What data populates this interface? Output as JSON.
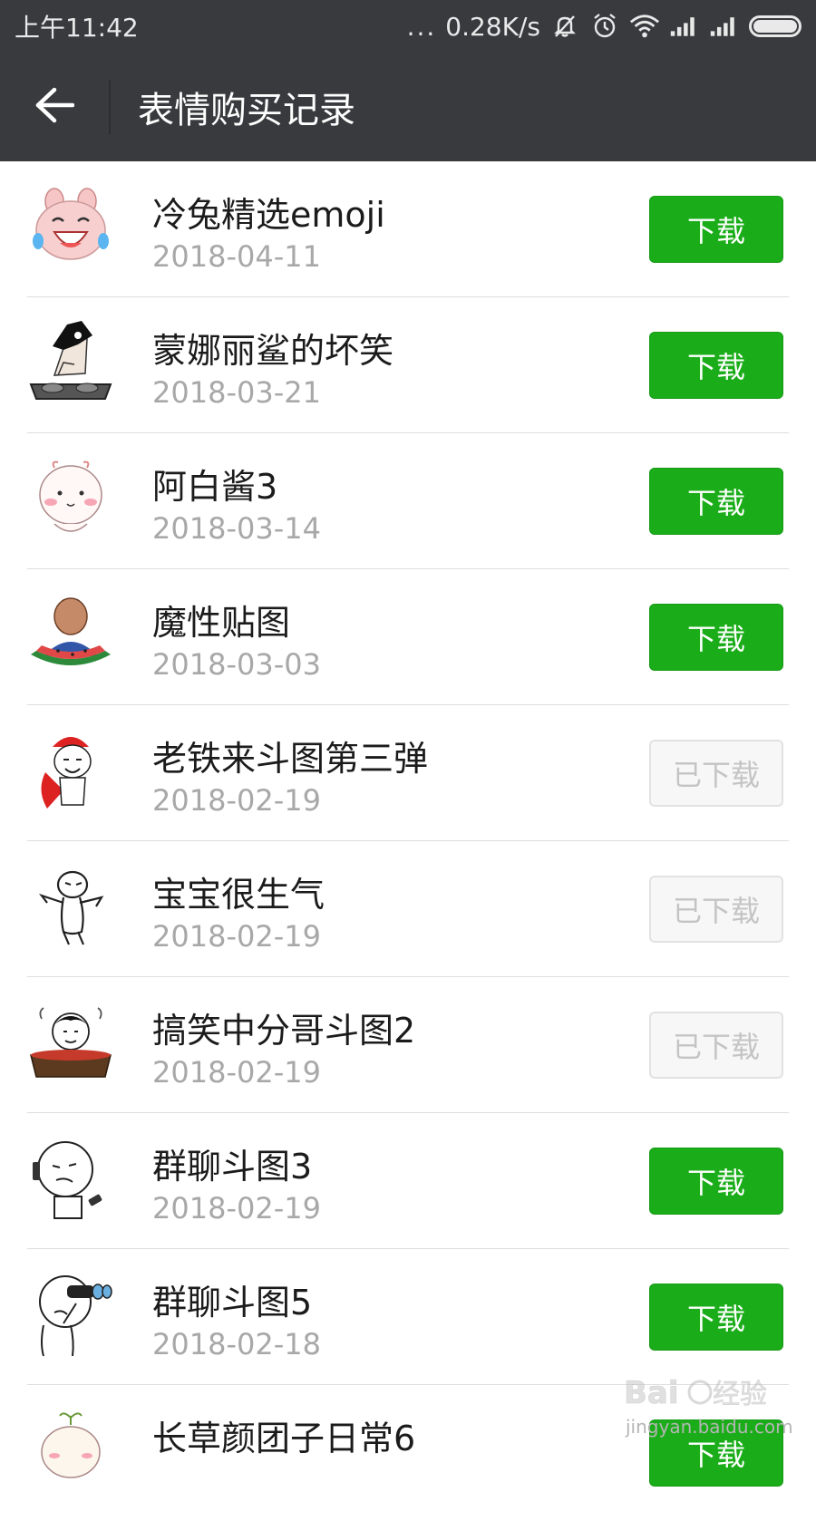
{
  "status_bar": {
    "time": "上午11:42",
    "more": "...",
    "speed": "0.28K/s",
    "icons": [
      "mute-bell-icon",
      "alarm-icon",
      "wifi-icon",
      "signal-icon",
      "signal-icon",
      "battery-icon"
    ]
  },
  "header": {
    "back_icon": "arrow-left-icon",
    "title": "表情购买记录"
  },
  "colors": {
    "bar_bg": "#393a3e",
    "accent_green": "#1aad19",
    "disabled_text": "#c4c4c4"
  },
  "items": [
    {
      "name": "冷兔精选emoji",
      "date": "2018-04-11",
      "button": "下载",
      "state": "download",
      "thumb": "laughing-rabbit-sticker"
    },
    {
      "name": "蒙娜丽鲨的坏笑",
      "date": "2018-03-21",
      "button": "下载",
      "state": "download",
      "thumb": "dj-shark-sticker"
    },
    {
      "name": "阿白酱3",
      "date": "2018-03-14",
      "button": "下载",
      "state": "download",
      "thumb": "white-bun-sticker"
    },
    {
      "name": "魔性贴图",
      "date": "2018-03-03",
      "button": "下载",
      "state": "download",
      "thumb": "watermelon-man-sticker"
    },
    {
      "name": "老铁来斗图第三弹",
      "date": "2018-02-19",
      "button": "已下载",
      "state": "downloaded",
      "thumb": "red-hat-man-sticker"
    },
    {
      "name": "宝宝很生气",
      "date": "2018-02-19",
      "button": "已下载",
      "state": "downloaded",
      "thumb": "angry-stickman-sticker"
    },
    {
      "name": "搞笑中分哥斗图2",
      "date": "2018-02-19",
      "button": "已下载",
      "state": "downloaded",
      "thumb": "hotpot-guy-sticker"
    },
    {
      "name": "群聊斗图3",
      "date": "2018-02-19",
      "button": "下载",
      "state": "download",
      "thumb": "phone-face-sticker"
    },
    {
      "name": "群聊斗图5",
      "date": "2018-02-18",
      "button": "下载",
      "state": "download",
      "thumb": "binocular-face-sticker"
    },
    {
      "name": "长草颜团子日常6",
      "date": "",
      "button": "下载",
      "state": "download",
      "thumb": "sprout-bun-sticker"
    }
  ],
  "watermark": {
    "logo": "Baidu经验",
    "url": "jingyan.baidu.com"
  }
}
